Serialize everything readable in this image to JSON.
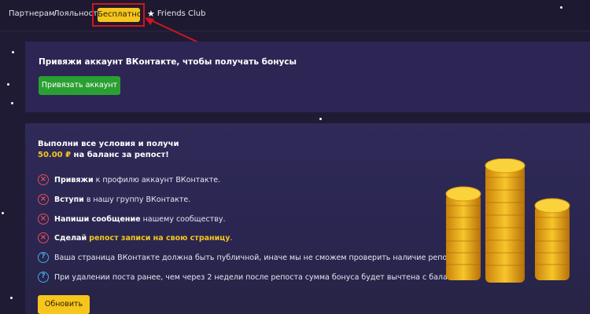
{
  "nav": {
    "partners": "Партнерам",
    "loyalty": "Лояльность",
    "free": "Бесплатно",
    "friends": "Friends Club",
    "friends_icon": "star-icon"
  },
  "bind_panel": {
    "title": "Привяжи аккаунт ВКонтакте, чтобы получать бонусы",
    "button": "Привязать аккаунт"
  },
  "main_panel": {
    "title_line1": "Выполни все условия и получи",
    "amount": "50.00 ₽",
    "title_line2_rest": " на баланс за репост!",
    "conditions": [
      {
        "icon": "x-circle-icon",
        "bold": "Привяжи",
        "text": " к профилю аккаунт ВКонтакте."
      },
      {
        "icon": "x-circle-icon",
        "bold": "Вступи",
        "text": " в нашу группу ВКонтакте."
      },
      {
        "icon": "x-circle-icon",
        "bold": "Напиши сообщение",
        "text": " нашему сообществу."
      },
      {
        "icon": "x-circle-icon",
        "bold": "Сделай",
        "highlight": "репост записи на свою страницу",
        "text": "."
      }
    ],
    "notes": [
      {
        "icon": "question-circle-icon",
        "text": "Ваша страница ВКонтакте должна быть публичной, иначе мы не сможем проверить наличие репоста."
      },
      {
        "icon": "question-circle-icon",
        "text": "При удалении поста ранее, чем через 2 недели после репоста сумма бонуса будет вычтена с баланса."
      }
    ],
    "refresh_button": "Обновить"
  },
  "colors": {
    "accent_yellow": "#f6c51e",
    "green_button": "#2aa033",
    "annotation_red": "#d0161d",
    "error_red": "#e44c5c",
    "info_blue": "#4aa6e8"
  }
}
